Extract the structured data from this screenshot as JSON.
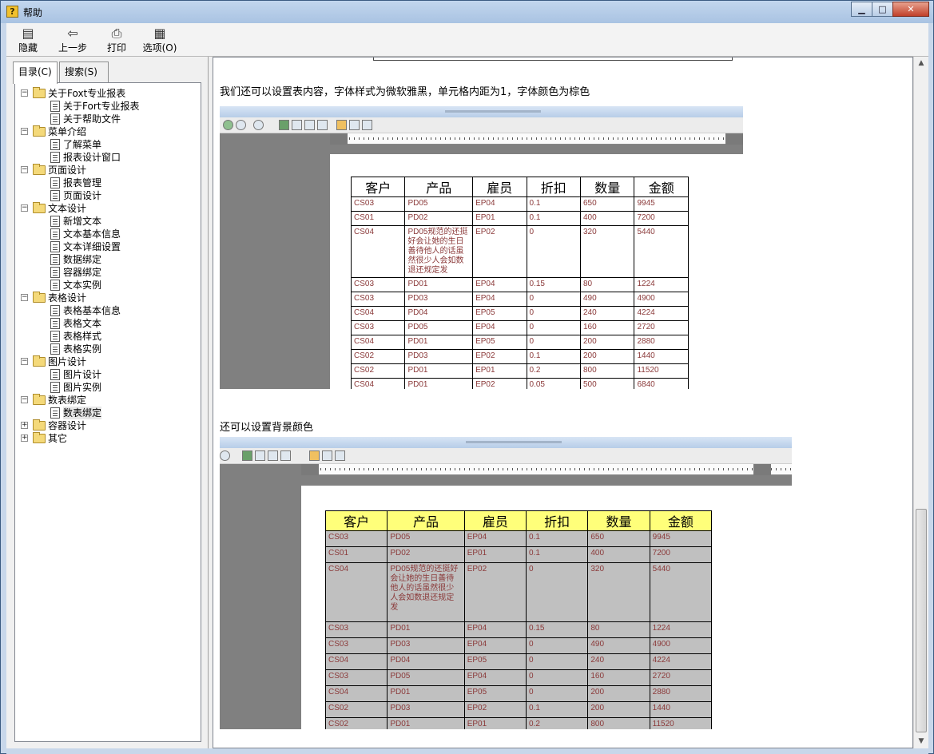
{
  "window": {
    "title": "帮助",
    "controls": {
      "minimize": "▁",
      "maximize": "□",
      "close": "✕"
    }
  },
  "toolbar": {
    "hide_label": "隐藏",
    "back_label": "上一步",
    "print_label": "打印",
    "options_label": "选项(O)"
  },
  "tabs": {
    "contents": "目录(C)",
    "search": "搜索(S)"
  },
  "tree": [
    {
      "label": "关于Foxt专业报表",
      "children": [
        "关于Fort专业报表",
        "关于帮助文件"
      ]
    },
    {
      "label": "菜单介绍",
      "children": [
        "了解菜单",
        "报表设计窗口"
      ]
    },
    {
      "label": "页面设计",
      "children": [
        "报表管理",
        "页面设计"
      ]
    },
    {
      "label": "文本设计",
      "children": [
        "新增文本",
        "文本基本信息",
        "文本详细设置",
        "数据绑定",
        "容器绑定",
        "文本实例"
      ]
    },
    {
      "label": "表格设计",
      "children": [
        "表格基本信息",
        "表格文本",
        "表格样式",
        "表格实例"
      ]
    },
    {
      "label": "图片设计",
      "children": [
        "图片设计",
        "图片实例"
      ]
    },
    {
      "label": "数表绑定",
      "children": [
        "数表绑定"
      ]
    },
    {
      "label": "容器设计",
      "children": []
    },
    {
      "label": "其它",
      "children": []
    }
  ],
  "content": {
    "para1": "我们还可以设置表内容，字体样式为微软雅黑，单元格内距为1，字体颜色为棕色",
    "para2": "还可以设置背景颜色",
    "table": {
      "headers": [
        "客户",
        "产品",
        "雇员",
        "折扣",
        "数量",
        "金额"
      ],
      "rows": [
        [
          "CS03",
          "PD05",
          "EP04",
          "0.1",
          "650",
          "9945"
        ],
        [
          "CS01",
          "PD02",
          "EP01",
          "0.1",
          "400",
          "7200"
        ],
        [
          "CS04",
          "PD05规范的还挺好会让她的生日善待他人的话虽然很少人会如数退还规定发",
          "EP02",
          "0",
          "320",
          "5440"
        ],
        [
          "CS03",
          "PD01",
          "EP04",
          "0.15",
          "80",
          "1224"
        ],
        [
          "CS03",
          "PD03",
          "EP04",
          "0",
          "490",
          "4900"
        ],
        [
          "CS04",
          "PD04",
          "EP05",
          "0",
          "240",
          "4224"
        ],
        [
          "CS03",
          "PD05",
          "EP04",
          "0",
          "160",
          "2720"
        ],
        [
          "CS04",
          "PD01",
          "EP05",
          "0",
          "200",
          "2880"
        ],
        [
          "CS02",
          "PD03",
          "EP02",
          "0.1",
          "200",
          "1440"
        ],
        [
          "CS02",
          "PD01",
          "EP01",
          "0.2",
          "800",
          "11520"
        ],
        [
          "CS04",
          "PD01",
          "EP02",
          "0.05",
          "500",
          "6840"
        ]
      ]
    }
  }
}
